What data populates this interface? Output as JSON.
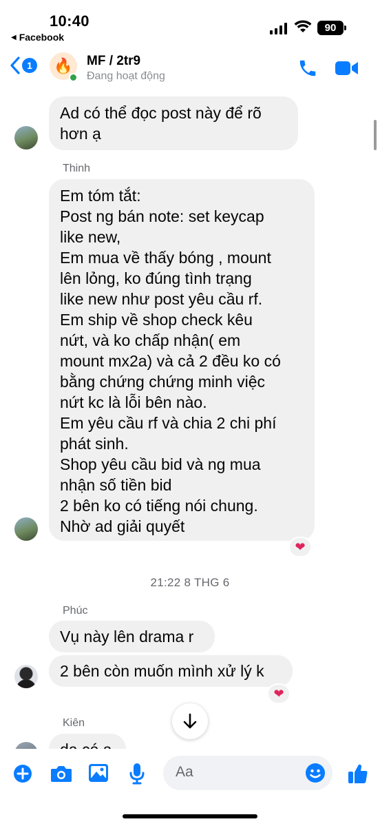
{
  "status_bar": {
    "time": "10:40",
    "back_app": "Facebook",
    "battery": "90"
  },
  "header": {
    "back_count": "1",
    "title": "MF / 2tr9",
    "status": "Đang hoạt động"
  },
  "messages": [
    {
      "sender": "",
      "text": "Ad có thể đọc post này để rõ\nhơn ạ"
    },
    {
      "sender": "Thinh",
      "text": "Em tóm tắt:\nPost ng bán note: set keycap\nlike new,\nEm mua về thấy bóng , mount\nlên lỏng, ko đúng tình trạng\nlike new như post yêu cầu rf.\nEm ship về shop check kêu\nnứt, và ko chấp nhận( em\nmount mx2a) và cả 2 đều ko có\nbằng chứng chứng minh việc\nnứt kc là lỗi bên nào.\nEm yêu cầu rf và chia 2 chi phí\nphát sinh.\nShop yêu cầu bid và ng mua\nnhận số tiền bid\n2 bên ko có tiếng nói chung.\nNhờ ad giải quyết",
      "reaction": "❤"
    },
    {
      "timestamp": "21:22 8 THG 6"
    },
    {
      "sender": "Phúc",
      "text": "Vụ này lên drama r"
    },
    {
      "sender": "",
      "text": "2 bên còn muốn mình xử lý k",
      "reaction": "❤"
    },
    {
      "sender": "Kiên",
      "text": "dạ có ạ"
    }
  ],
  "composer": {
    "placeholder": "Aa"
  },
  "icons": {
    "back": "chevron-left-icon",
    "call": "phone-icon",
    "video": "video-camera-icon",
    "plus": "plus-circle-icon",
    "camera": "camera-icon",
    "gallery": "image-icon",
    "mic": "microphone-icon",
    "emoji": "smiley-icon",
    "like": "thumbs-up-icon",
    "scroll": "arrow-down-icon"
  },
  "colors": {
    "accent": "#0a7cff",
    "bubble": "#f0f0f0",
    "reaction": "#e0245e",
    "online": "#31a24c"
  }
}
